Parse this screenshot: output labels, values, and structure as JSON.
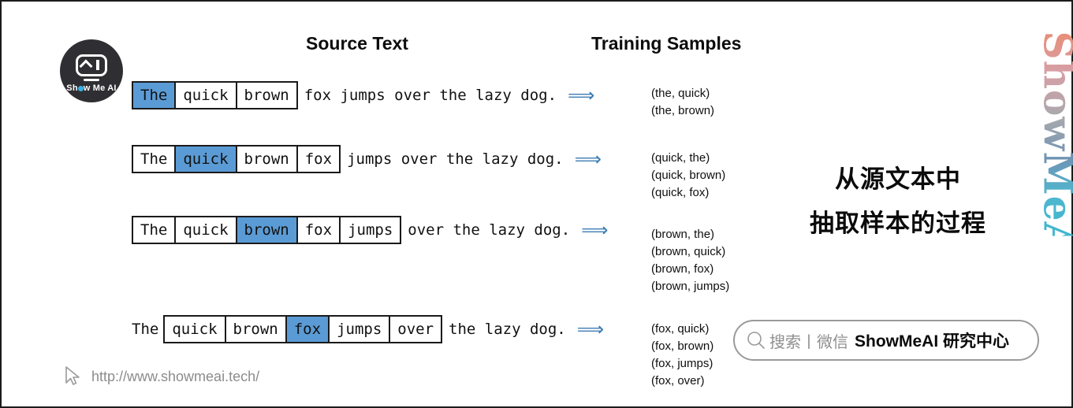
{
  "page": {
    "border_color": "#1b1b1b",
    "background": "#ffffff"
  },
  "logo": {
    "name": "Show Me AI",
    "text_part1": "Sh",
    "text_part2": "w Me AI",
    "circle_color": "#2f2f33",
    "dot_color": "#35b3e8"
  },
  "headers": {
    "source": "Source Text",
    "samples": "Training Samples"
  },
  "highlight_color": "#5b9bd5",
  "arrow_color": "#3d7cb3",
  "arrow_glyph": "⟹",
  "rows": [
    {
      "lead": "",
      "tokens": [
        "The",
        "quick",
        "brown"
      ],
      "highlight_index": 0,
      "tail": "fox jumps over the lazy dog."
    },
    {
      "lead": "",
      "tokens": [
        "The",
        "quick",
        "brown",
        "fox"
      ],
      "highlight_index": 1,
      "tail": "jumps over the lazy dog."
    },
    {
      "lead": "",
      "tokens": [
        "The",
        "quick",
        "brown",
        "fox",
        "jumps"
      ],
      "highlight_index": 2,
      "tail": "over the lazy dog."
    },
    {
      "lead": "The",
      "tokens": [
        "quick",
        "brown",
        "fox",
        "jumps",
        "over"
      ],
      "highlight_index": 2,
      "tail": "the lazy dog."
    }
  ],
  "samples": [
    "(the, quick)\n(the, brown)",
    "(quick, the)\n(quick, brown)\n(quick, fox)",
    "(brown, the)\n(brown, quick)\n(brown, fox)\n(brown, jumps)",
    "(fox, quick)\n(fox, brown)\n(fox, jumps)\n(fox, over)"
  ],
  "caption": {
    "line1": "从源文本中",
    "line2": "抽取样本的过程"
  },
  "search_pill": {
    "gray_text": "搜索丨微信",
    "bold_text": "ShowMeAI 研究中心",
    "border_color": "#9a9a9a"
  },
  "watermark": {
    "text": "ShowMeAI"
  },
  "footer": {
    "url": "http://www.showmeai.tech/",
    "color": "#8c8c8c"
  }
}
